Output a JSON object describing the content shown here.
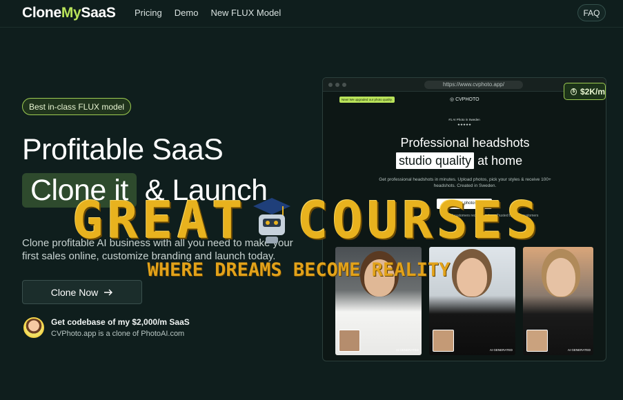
{
  "nav": {
    "logo_a": "Clone",
    "logo_b": "My",
    "logo_c": "SaaS",
    "links": [
      "Pricing",
      "Demo",
      "New FLUX Model"
    ],
    "faq": "FAQ"
  },
  "hero": {
    "badge": "Best in-class FLUX model",
    "title_line1": "Profitable SaaS",
    "title_highlight": "Clone it",
    "title_rest": "& Launch",
    "description": "Clone profitable AI business with all you need to make your first sales online, customize branding and launch today.",
    "cta": "Clone Now",
    "cta_icon": "arrow-right-icon",
    "promo_title": "Get codebase of my $2,000/m SaaS",
    "promo_sub": "CVPhoto.app is a clone of PhotoAI.com"
  },
  "mockup": {
    "url": "https://www.cvphoto.app/",
    "notice": "New! We upgraded our photo quality.",
    "site_name": "CVPHOTO",
    "ranked_line1": "#1 AI Photo in Sweden",
    "ranked_stars": "★★★★★",
    "title": "Professional headshots",
    "subtitle_highlight": "studio quality",
    "subtitle_rest": "at home",
    "description": "Get professional headshots in minutes. Upload photos, pick your styles & receive 100+ headshots. Created in Sweden.",
    "button": "Get your photos →",
    "social": "92% of customers recommend us · Trusted by 100+ customers",
    "photo_tag": "AI GENERATED",
    "price_badge": "$2K/m"
  },
  "watermark": {
    "word1": "GREAT",
    "word2": "COURSES",
    "tagline": "WHERE DREAMS BECOME REALITY"
  },
  "colors": {
    "background": "#0f1e1d",
    "accent": "#b9e35a",
    "watermark": "#e8b21e"
  }
}
